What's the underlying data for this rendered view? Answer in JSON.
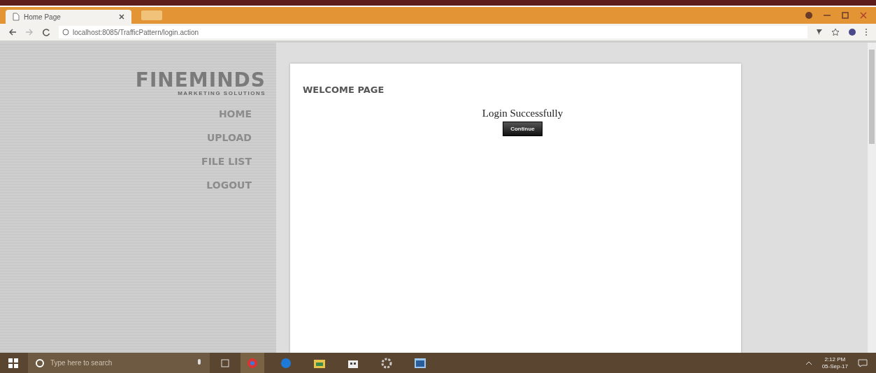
{
  "browser": {
    "tab_title": "Home Page",
    "url": "localhost:8085/TrafficPattern/login.action"
  },
  "site": {
    "logo": "FINEMINDS",
    "tagline": "MARKETING SOLUTIONS",
    "nav": [
      {
        "label": "HOME",
        "selected": false
      },
      {
        "label": "UPLOAD",
        "selected": false
      },
      {
        "label": "FILE LIST",
        "selected": false
      },
      {
        "label": "LOGOUT",
        "selected": false
      }
    ]
  },
  "content": {
    "heading": "WELCOME PAGE",
    "message": "Login Successfully",
    "button": "Continue"
  },
  "taskbar": {
    "search_placeholder": "Type here to search",
    "time": "2:12 PM",
    "date": "05-Sep-17"
  }
}
